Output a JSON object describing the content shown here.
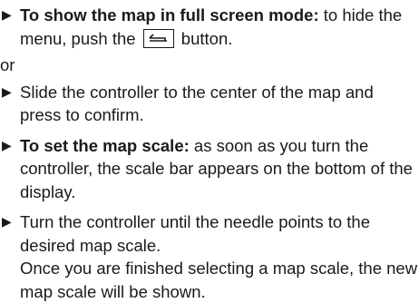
{
  "steps": [
    {
      "lead": "To show the map in full screen mode:",
      "text_before_key": " to hide the menu, push the ",
      "key_icon": "back-arrow-icon",
      "text_after_key": " button."
    },
    {
      "text": "Slide the controller to the center of the map and press to confirm."
    },
    {
      "lead": "To set the map scale:",
      "text": " as soon as you turn the controller, the scale bar appears on the bottom of the display."
    },
    {
      "text": "Turn the controller until the needle points to the desired map scale.",
      "note": "Once you are finished selecting a map scale, the new map scale will be shown."
    }
  ],
  "separator": "or",
  "bullet_glyph": "▶"
}
